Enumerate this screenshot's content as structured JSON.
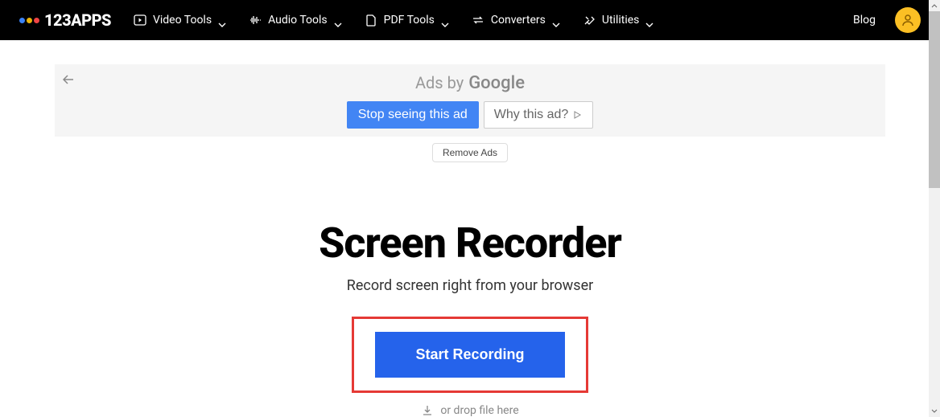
{
  "header": {
    "logo_text": "123APPS",
    "nav": [
      {
        "label": "Video Tools"
      },
      {
        "label": "Audio Tools"
      },
      {
        "label": "PDF Tools"
      },
      {
        "label": "Converters"
      },
      {
        "label": "Utilities"
      }
    ],
    "blog": "Blog"
  },
  "ad": {
    "ads_by": "Ads by",
    "google": "Google",
    "stop_label": "Stop seeing this ad",
    "why_label": "Why this ad?",
    "remove_label": "Remove Ads"
  },
  "main": {
    "title": "Screen Recorder",
    "subtitle": "Record screen right from your browser",
    "start_button": "Start Recording",
    "drop_hint": "or drop file here"
  }
}
